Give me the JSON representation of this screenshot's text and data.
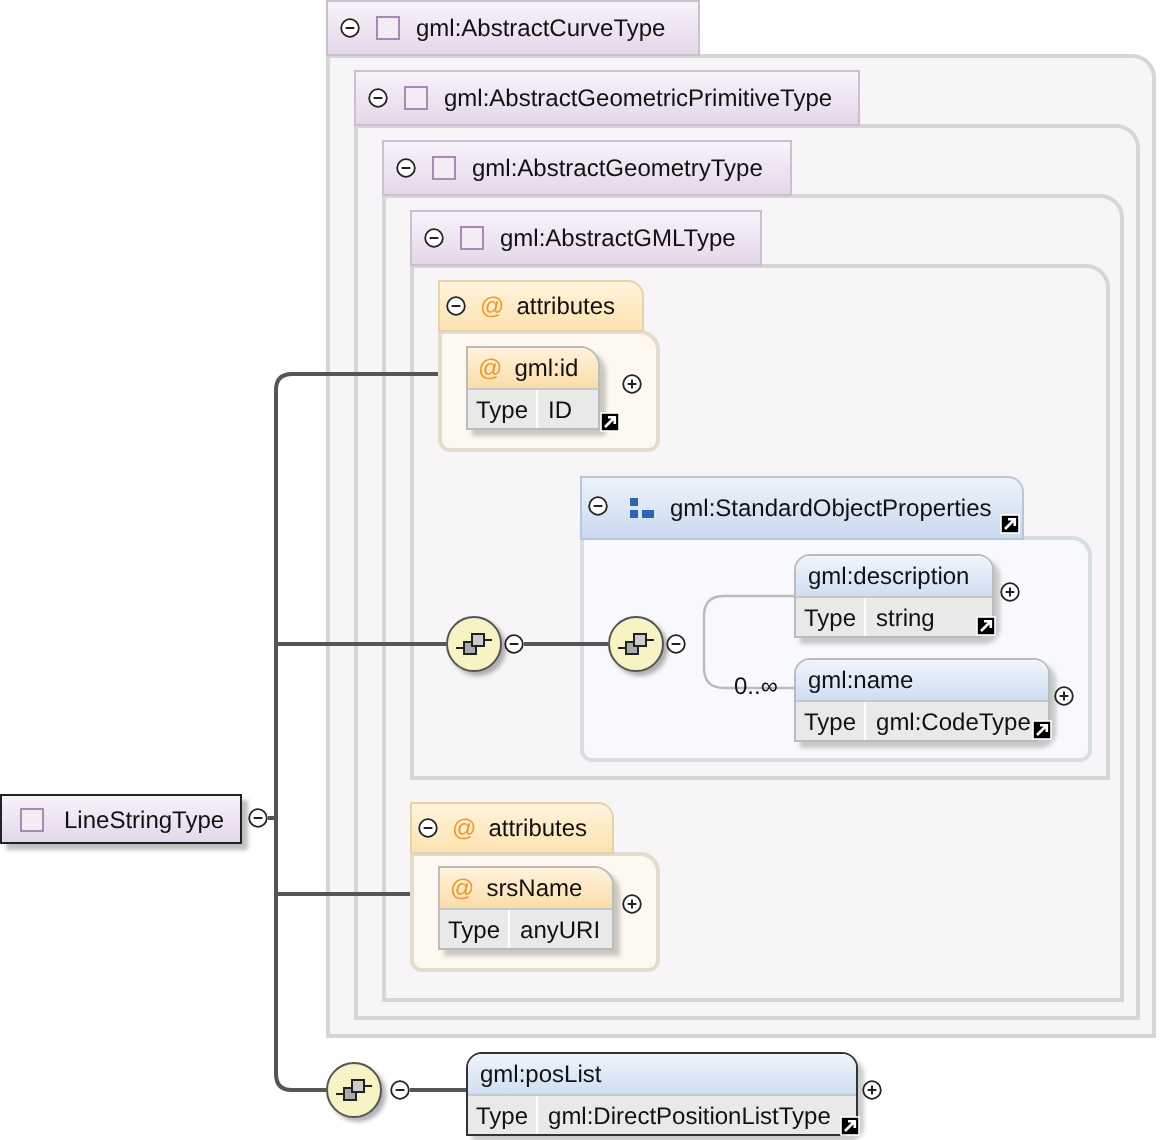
{
  "root": {
    "label": "LineStringType",
    "expanded": true
  },
  "base_types": [
    {
      "label": "gml:AbstractCurveType",
      "expanded": true
    },
    {
      "label": "gml:AbstractGeometricPrimitiveType",
      "expanded": true
    },
    {
      "label": "gml:AbstractGeometryType",
      "expanded": true
    },
    {
      "label": "gml:AbstractGMLType",
      "expanded": true
    }
  ],
  "id_attributes": {
    "marker": "@",
    "label": "attributes",
    "expanded": true,
    "attribute": {
      "marker": "@",
      "name": "gml:id",
      "type_label": "Type",
      "type": "ID",
      "expanded": false
    }
  },
  "properties_sequence": {
    "expanded": true
  },
  "properties_group": {
    "label": "gml:StandardObjectProperties",
    "expanded": true,
    "sequence_expanded": true,
    "elements": [
      {
        "name": "gml:description",
        "type_label": "Type",
        "type": "string",
        "expanded": false
      },
      {
        "name": "gml:name",
        "type_label": "Type",
        "type": "gml:CodeType",
        "expanded": false,
        "occurrence": "0..∞"
      }
    ]
  },
  "srs_attributes": {
    "marker": "@",
    "label": "attributes",
    "expanded": true,
    "attribute": {
      "marker": "@",
      "name": "srsName",
      "type_label": "Type",
      "type": "anyURI",
      "expanded": false
    }
  },
  "pos_list_sequence": {
    "expanded": true
  },
  "pos_list": {
    "name": "gml:posList",
    "type_label": "Type",
    "type": "gml:DirectPositionListType",
    "expanded": false
  }
}
